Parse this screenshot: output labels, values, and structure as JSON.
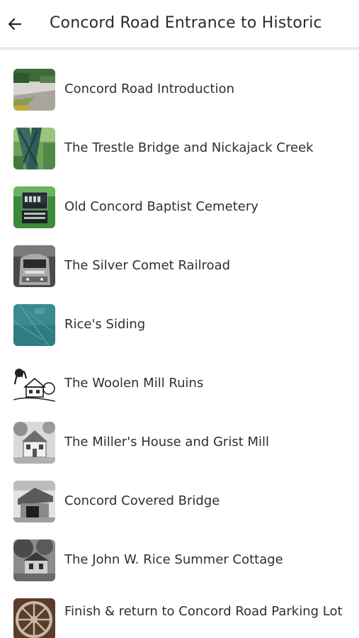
{
  "header": {
    "back_icon": "arrow-left-icon",
    "title": "Concord Road Entrance to Historic"
  },
  "stops": [
    {
      "label": "Concord Road Introduction",
      "icon": "road-photo"
    },
    {
      "label": "The Trestle Bridge and Nickajack Creek",
      "icon": "trestle-bridge-photo"
    },
    {
      "label": "Old Concord Baptist Cemetery",
      "icon": "cemetery-sign-photo"
    },
    {
      "label": "The Silver Comet Railroad",
      "icon": "locomotive-photo"
    },
    {
      "label": "Rice's Siding",
      "icon": "map-photo"
    },
    {
      "label": "The Woolen Mill Ruins",
      "icon": "mill-sketch"
    },
    {
      "label": "The Miller's House and Grist Mill",
      "icon": "house-photo"
    },
    {
      "label": "Concord Covered Bridge",
      "icon": "covered-bridge-photo"
    },
    {
      "label": "The John W. Rice Summer Cottage",
      "icon": "cottage-photo"
    },
    {
      "label": "Finish & return to Concord Road Parking Lot",
      "icon": "wheel-photo"
    }
  ]
}
